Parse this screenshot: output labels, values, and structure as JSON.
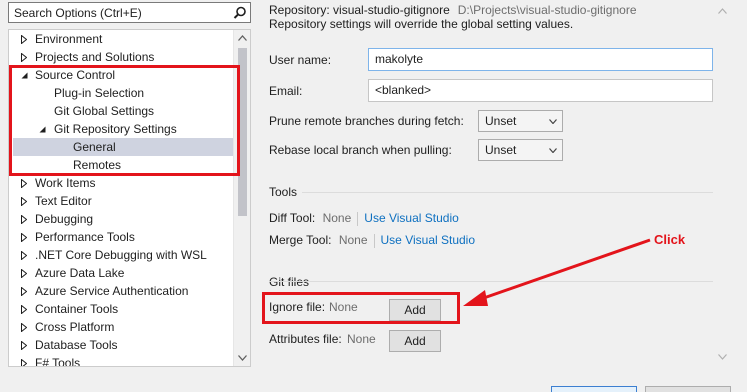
{
  "search": {
    "placeholder": "Search Options (Ctrl+E)"
  },
  "tree": {
    "items": [
      {
        "label": "Environment",
        "expanded": false,
        "level": 0
      },
      {
        "label": "Projects and Solutions",
        "expanded": false,
        "level": 0
      },
      {
        "label": "Source Control",
        "expanded": true,
        "level": 0
      },
      {
        "label": "Plug-in Selection",
        "level": 1
      },
      {
        "label": "Git Global Settings",
        "level": 1
      },
      {
        "label": "Git Repository Settings",
        "expanded": true,
        "level": 1
      },
      {
        "label": "General",
        "level": 2,
        "selected": true
      },
      {
        "label": "Remotes",
        "level": 2
      },
      {
        "label": "Work Items",
        "expanded": false,
        "level": 0
      },
      {
        "label": "Text Editor",
        "expanded": false,
        "level": 0
      },
      {
        "label": "Debugging",
        "expanded": false,
        "level": 0
      },
      {
        "label": "Performance Tools",
        "expanded": false,
        "level": 0
      },
      {
        "label": ".NET Core Debugging with WSL",
        "expanded": false,
        "level": 0
      },
      {
        "label": "Azure Data Lake",
        "expanded": false,
        "level": 0
      },
      {
        "label": "Azure Service Authentication",
        "expanded": false,
        "level": 0
      },
      {
        "label": "Container Tools",
        "expanded": false,
        "level": 0
      },
      {
        "label": "Cross Platform",
        "expanded": false,
        "level": 0
      },
      {
        "label": "Database Tools",
        "expanded": false,
        "level": 0
      },
      {
        "label": "F# Tools",
        "expanded": false,
        "level": 0
      }
    ]
  },
  "repo": {
    "title": "Repository: visual-studio-gitignore",
    "path": "D:\\Projects\\visual-studio-gitignore",
    "description": "Repository settings will override the global setting values."
  },
  "form": {
    "username_label": "User name:",
    "username_value": "makolyte",
    "email_label": "Email:",
    "email_value": "<blanked>",
    "prune_label": "Prune remote branches during fetch:",
    "prune_value": "Unset",
    "rebase_label": "Rebase local branch when pulling:",
    "rebase_value": "Unset"
  },
  "tools": {
    "section_title": "Tools",
    "diff_label": "Diff Tool:",
    "diff_value": "None",
    "diff_link": "Use Visual Studio",
    "merge_label": "Merge Tool:",
    "merge_value": "None",
    "merge_link": "Use Visual Studio"
  },
  "gitfiles": {
    "section_title": "Git files",
    "ignore_label": "Ignore file:",
    "ignore_value": "None",
    "ignore_button": "Add",
    "attributes_label": "Attributes file:",
    "attributes_value": "None",
    "attributes_button": "Add"
  },
  "annotation": {
    "click_text": "Click",
    "color": "#e3141b"
  },
  "colors": {
    "accent": "#0e70c0",
    "selection": "#cfd3e0",
    "highlight_red": "#e3141b"
  }
}
